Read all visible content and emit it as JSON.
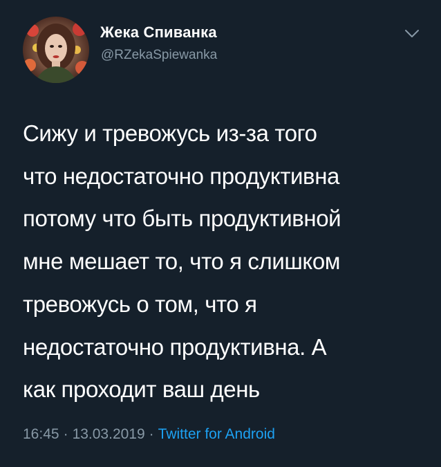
{
  "user": {
    "display_name": "Жека Спиванка",
    "handle": "@RZekaSpiewanka",
    "avatar_icon": "avatar-portrait"
  },
  "menu": {
    "icon": "chevron-down-icon"
  },
  "tweet": {
    "lines": [
      "Сижу и тревожусь из-за того",
      "что недостаточно продуктивна",
      "потому что быть продуктивной",
      "мне мешает то, что я слишком",
      "тревожусь о том, что я",
      "недостаточно продуктивна. А",
      "как проходит ваш день"
    ]
  },
  "meta": {
    "time": "16:45",
    "separator": "·",
    "date": "13.03.2019",
    "source": "Twitter for Android"
  },
  "colors": {
    "background": "#15202b",
    "text": "#ffffff",
    "secondary": "#8899a6",
    "link": "#1da1f2"
  }
}
